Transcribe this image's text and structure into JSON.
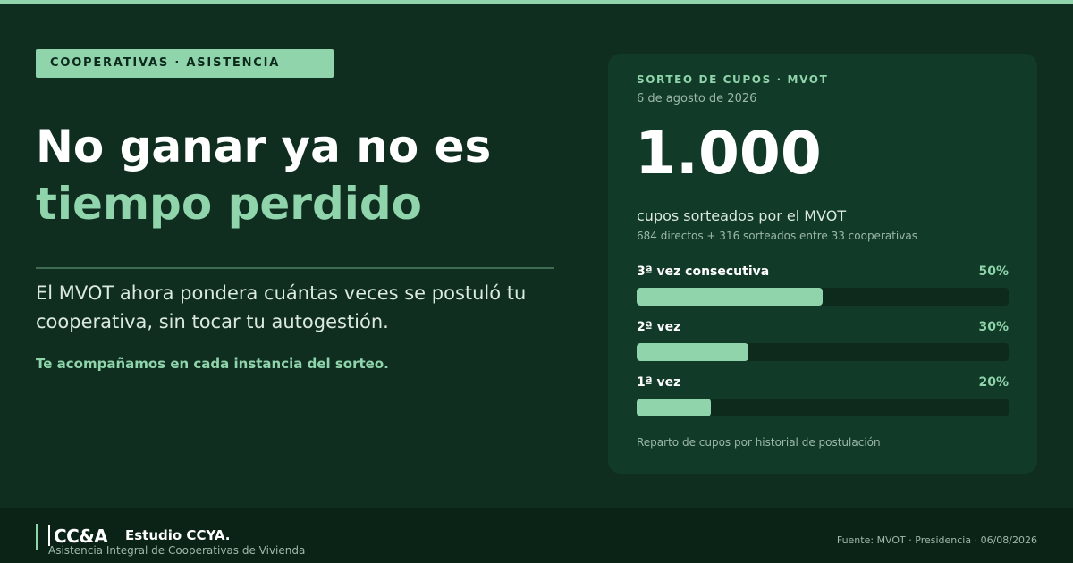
{
  "header": {
    "tag": "COOPERATIVAS · ASISTENCIA",
    "headline_line1": "No ganar ya no es",
    "headline_line2": "tiempo perdido"
  },
  "main": {
    "body": "El MVOT ahora pondera cuántas veces se postuló tu cooperativa, sin tocar tu autogestión.",
    "accompany": "Te acompañamos en cada instancia del sorteo."
  },
  "card": {
    "label": "SORTEO DE CUPOS · MVOT",
    "date": "6 de agosto de 2026",
    "big_number": "1.000",
    "subtitle": "cupos sorteados por el MVOT",
    "detail": "684 directos + 316 sorteados entre 33 cooperativas",
    "bars": [
      {
        "label": "3ª vez consecutiva",
        "pct_label": "50%",
        "value": 50
      },
      {
        "label": "2ª vez",
        "pct_label": "30%",
        "value": 30
      },
      {
        "label": "1ª vez",
        "pct_label": "20%",
        "value": 20
      }
    ],
    "caption": "Reparto de cupos por historial de postulación"
  },
  "footer": {
    "logo": "CC&A",
    "studio_name": "Estudio CCYA.",
    "studio_sub": "Asistencia Integral de Cooperativas de Vivienda",
    "source": "Fuente: MVOT · Presidencia · 06/08/2026"
  },
  "colors": {
    "background": "#0f2e20",
    "card": "#123a28",
    "accent": "#8fd4ab",
    "footer": "#0b2317"
  }
}
